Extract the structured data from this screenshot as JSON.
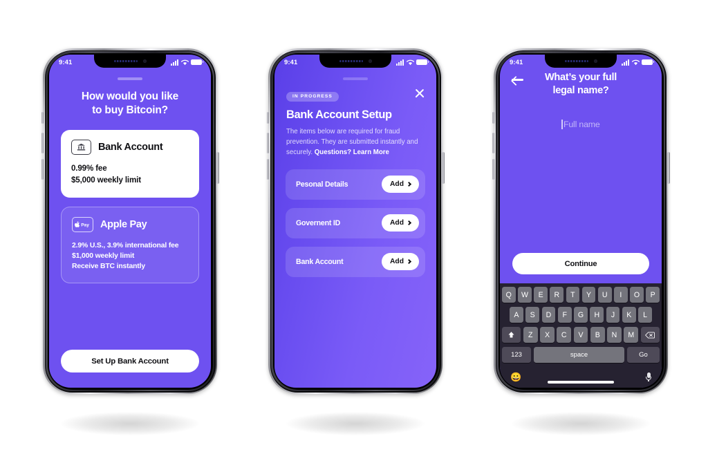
{
  "meta": {
    "accent_purple": "#6e51f0",
    "gradient_from": "#5a3fe8",
    "gradient_to": "#8663f9",
    "white": "#ffffff"
  },
  "phones": [
    {
      "status_bar": {
        "time": "9:41"
      },
      "screen": {
        "title": "How would you like\nto buy Bitcoin?",
        "title_line1": "How would you like",
        "title_line2": "to buy Bitcoin?",
        "options": [
          {
            "icon": "bank-icon",
            "name": "Bank Account",
            "details": [
              "0.99% fee",
              "$5,000 weekly limit"
            ]
          },
          {
            "icon": "apple-pay-icon",
            "name": "Apple Pay",
            "details": [
              "2.9% U.S., 3.9% international fee",
              "$1,000 weekly limit",
              "Receive BTC instantly"
            ]
          }
        ],
        "cta": "Set Up Bank Account"
      }
    },
    {
      "status_bar": {
        "time": "9:41"
      },
      "screen": {
        "badge": "IN PROGRESS",
        "title": "Bank Account Setup",
        "body_text": "The items below are required for fraud prevention. They are submitted instantly and securely. ",
        "body_link": "Questions? Learn More",
        "close_label": "Close",
        "rows": [
          {
            "label": "Pesonal Details",
            "action": "Add"
          },
          {
            "label": "Governent ID",
            "action": "Add"
          },
          {
            "label": "Bank Account",
            "action": "Add"
          }
        ]
      }
    },
    {
      "status_bar": {
        "time": "9:41"
      },
      "screen": {
        "title_line1": "What’s your full",
        "title_line2": "legal name?",
        "back_label": "Back",
        "input": {
          "value": "",
          "placeholder": "Full name"
        },
        "cta": "Continue",
        "keyboard": {
          "row1": [
            "Q",
            "W",
            "E",
            "R",
            "T",
            "Y",
            "U",
            "I",
            "O",
            "P"
          ],
          "row2": [
            "A",
            "S",
            "D",
            "F",
            "G",
            "H",
            "J",
            "K",
            "L"
          ],
          "row3": [
            "Z",
            "X",
            "C",
            "V",
            "B",
            "N",
            "M"
          ],
          "shift": "⬆",
          "backspace": "⌫",
          "numbers": "123",
          "space": "space",
          "go": "Go",
          "emoji": "😀",
          "dictate": "mic-icon"
        }
      }
    }
  ]
}
